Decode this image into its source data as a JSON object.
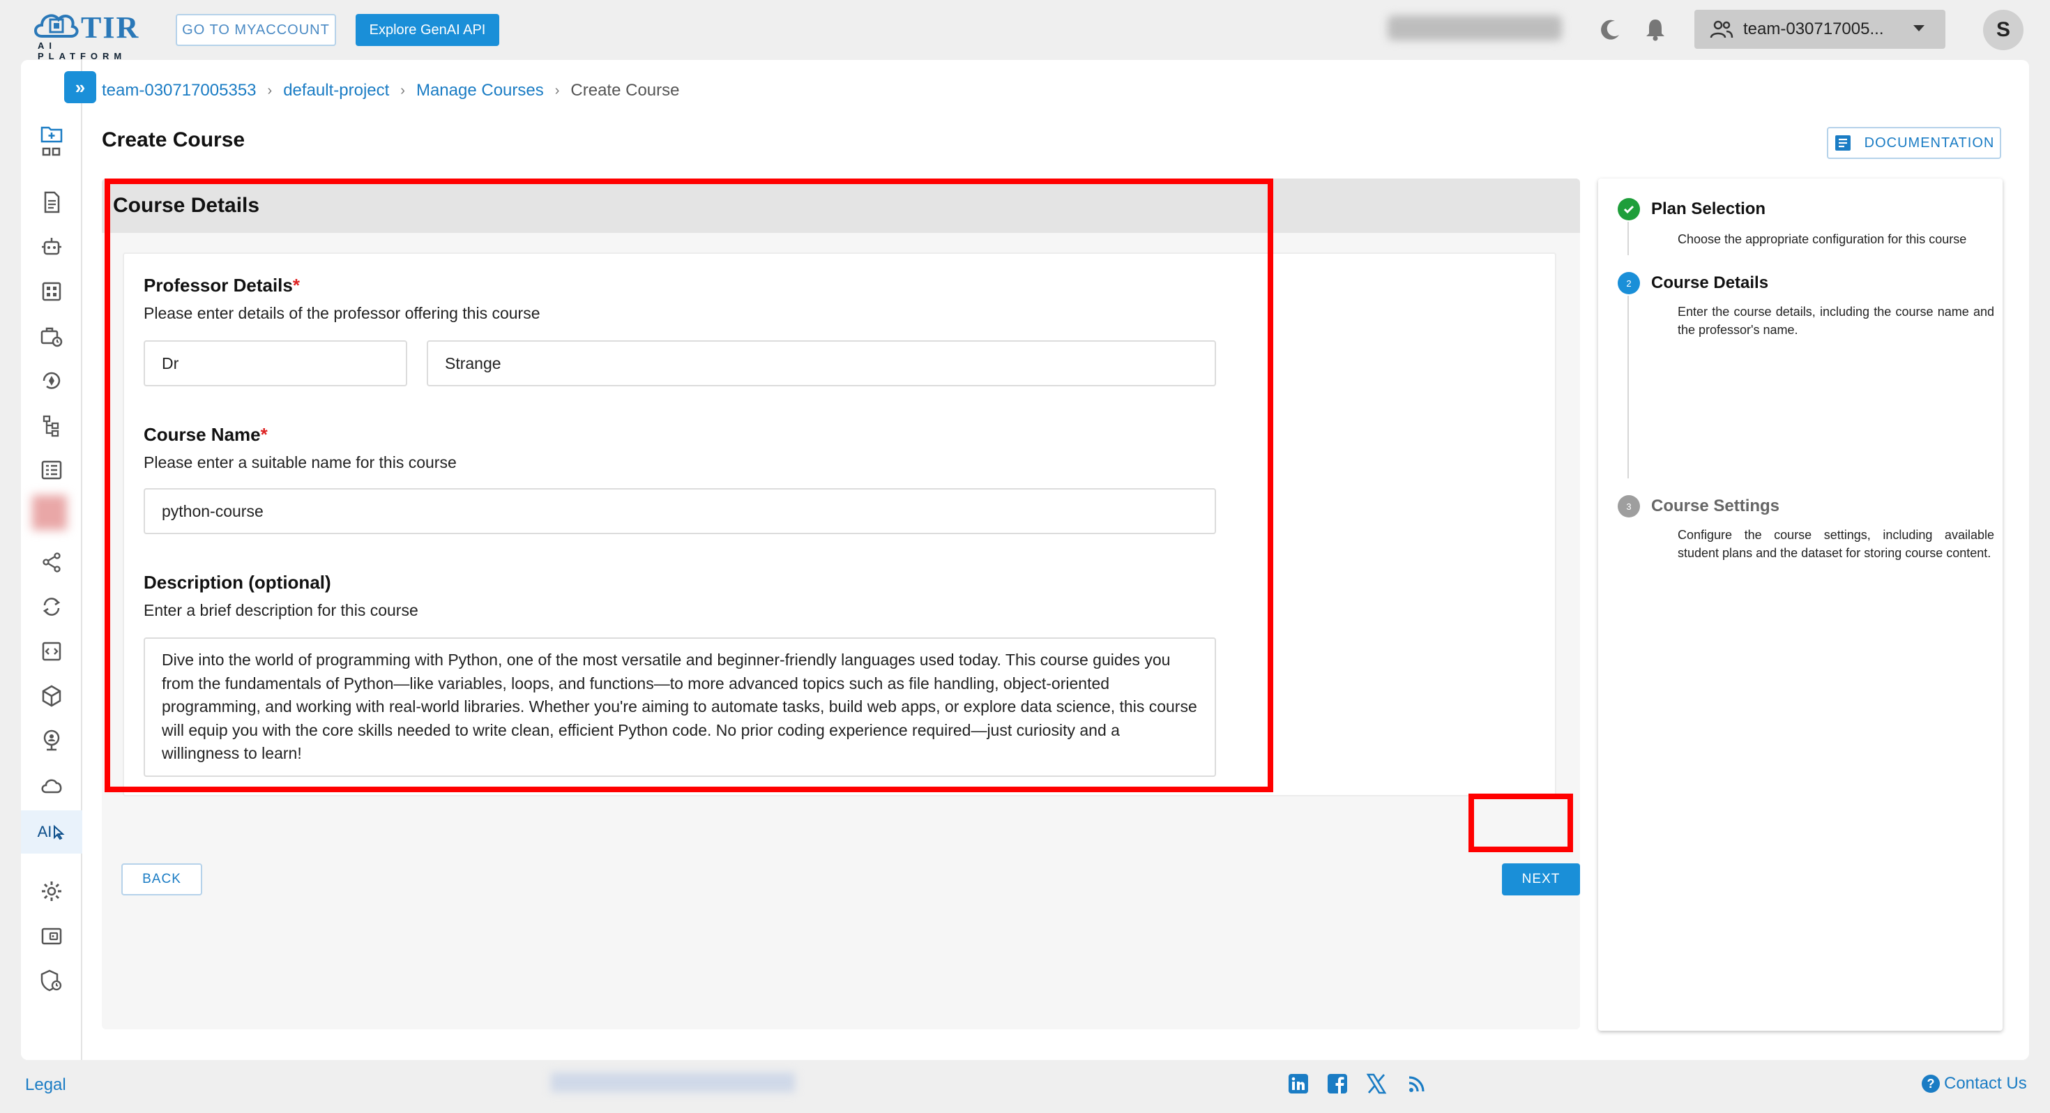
{
  "header": {
    "logo_text": "TIR",
    "logo_sub": "AI PLATFORM",
    "myaccount_label": "GO TO MYACCOUNT",
    "genai_label": "Explore GenAI API",
    "team_select": "team-030717005..."
  },
  "user": {
    "avatar_initial": "S"
  },
  "breadcrumb": [
    "team-030717005353",
    "default-project",
    "Manage Courses",
    "Create Course"
  ],
  "page": {
    "title": "Create Course",
    "documentation_label": "DOCUMENTATION"
  },
  "sidebar": {
    "ai_label": "AI"
  },
  "form": {
    "section_title": "Course Details",
    "professor": {
      "label": "Professor Details",
      "required_mark": "*",
      "help": "Please enter details of the professor offering this course",
      "title_value": "Dr",
      "name_value": "Strange"
    },
    "course_name": {
      "label": "Course Name",
      "required_mark": "*",
      "help": "Please enter a suitable name for this course",
      "value": "python-course"
    },
    "description": {
      "label": "Description (optional)",
      "help": "Enter a brief description for this course",
      "value": "Dive into the world of programming with Python, one of the most versatile and beginner-friendly languages used today. This course guides you from the fundamentals of Python—like variables, loops, and functions—to more advanced topics such as file handling, object-oriented programming, and working with real-world libraries. Whether you're aiming to automate tasks, build web apps, or explore data science, this course will equip you with the core skills needed to write clean, efficient Python code. No prior coding experience required—just curiosity and a willingness to learn!"
    },
    "back_label": "BACK",
    "next_label": "NEXT"
  },
  "stepper": {
    "steps": [
      {
        "number": "1",
        "title": "Plan Selection",
        "description": "Choose the appropriate configuration for this course",
        "state": "completed"
      },
      {
        "number": "2",
        "title": "Course Details",
        "description": "Enter the course details, including the course name and the professor's name.",
        "state": "active"
      },
      {
        "number": "3",
        "title": "Course Settings",
        "description": "Configure the course settings, including available student plans and the dataset for storing course content.",
        "state": "pending"
      }
    ]
  },
  "footer": {
    "legal_label": "Legal",
    "contact_label": "Contact Us",
    "contact_icon": "?"
  },
  "colors": {
    "accent": "#1a8fd8",
    "link": "#1a7cc4",
    "highlight": "#ff0000",
    "success": "#1e9e3a"
  }
}
